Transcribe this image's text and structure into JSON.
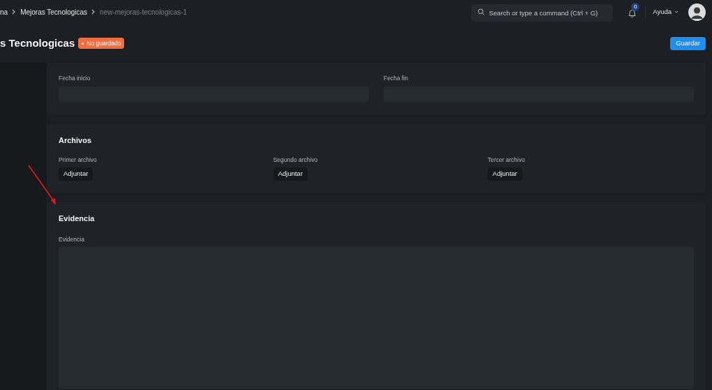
{
  "breadcrumbs": [
    {
      "label": "na",
      "current": false
    },
    {
      "label": "Mejoras Tecnologicas",
      "current": false
    },
    {
      "label": "new-mejoras-tecnologicas-1",
      "current": true
    }
  ],
  "search": {
    "placeholder": "Search or type a command (Ctrl + G)"
  },
  "notifications": {
    "count": "0"
  },
  "help_menu": {
    "label": "Ayuda"
  },
  "title": "s Tecnologicas",
  "status_badge": "No guardado",
  "save_button": "Guardar",
  "periodo": {
    "fields": [
      {
        "label": "Fecha inicio"
      },
      {
        "label": "Fecha fin"
      }
    ]
  },
  "archivos": {
    "title": "Archivos",
    "fields": [
      {
        "label": "Primer archivo",
        "button": "Adjuntar"
      },
      {
        "label": "Segundo archivo",
        "button": "Adjuntar"
      },
      {
        "label": "Tercer archivo",
        "button": "Adjuntar"
      }
    ]
  },
  "evidencia": {
    "title": "Evidencia",
    "field_label": "Evidencia"
  }
}
